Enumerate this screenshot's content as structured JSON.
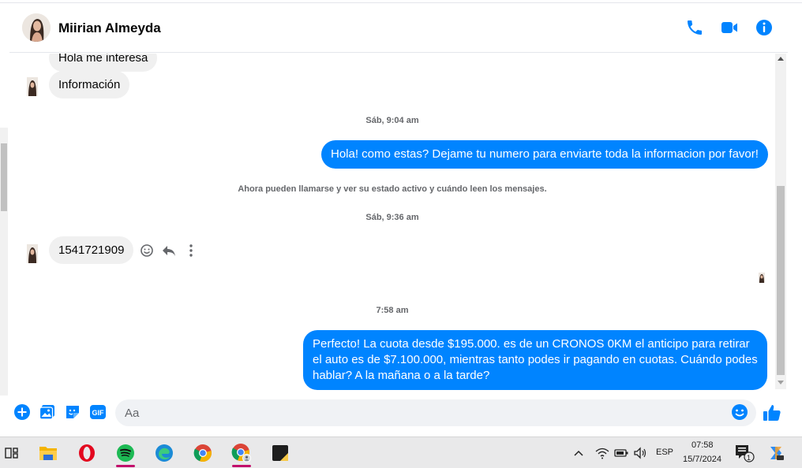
{
  "header": {
    "contact_name": "Miirian Almeyda",
    "icons": [
      "phone-icon",
      "video-call-icon",
      "info-icon"
    ]
  },
  "messages": {
    "partial_top": "Hola me interesa",
    "info": "Información",
    "ts1": "Sáb, 9:04 am",
    "out1": "Hola! como estas? Dejame tu numero para enviarte toda la informacion por favor!",
    "system_note": "Ahora pueden llamarse y ver su estado activo y cuándo leen los mensajes.",
    "ts2": "Sáb, 9:36 am",
    "phone_msg": "1541721909",
    "ts3": "7:58 am",
    "out2": "Perfecto! La cuota desde $195.000. es de un CRONOS 0KM el anticipo para retirar el auto es de $7.100.000, mientras tanto podes ir pagando en cuotas. Cuándo podes hablar? A la mañana o a la tarde?"
  },
  "composer": {
    "placeholder": "Aa",
    "icons": [
      "add-icon",
      "photo-icon",
      "sticker-icon",
      "gif-icon",
      "emoji-icon",
      "like-icon"
    ],
    "gif_label": "GIF"
  },
  "taskbar": {
    "apps": [
      "task-view-icon",
      "file-explorer-icon",
      "opera-icon",
      "spotify-icon",
      "edge-icon",
      "chrome-icon",
      "chrome-profile-icon",
      "sticky-notes-icon"
    ],
    "lang": "ESP",
    "time": "07:58",
    "date": "15/7/2024",
    "notification_count": "1"
  },
  "colors": {
    "accent": "#0084ff",
    "bubble_in": "#f0f0f0"
  }
}
